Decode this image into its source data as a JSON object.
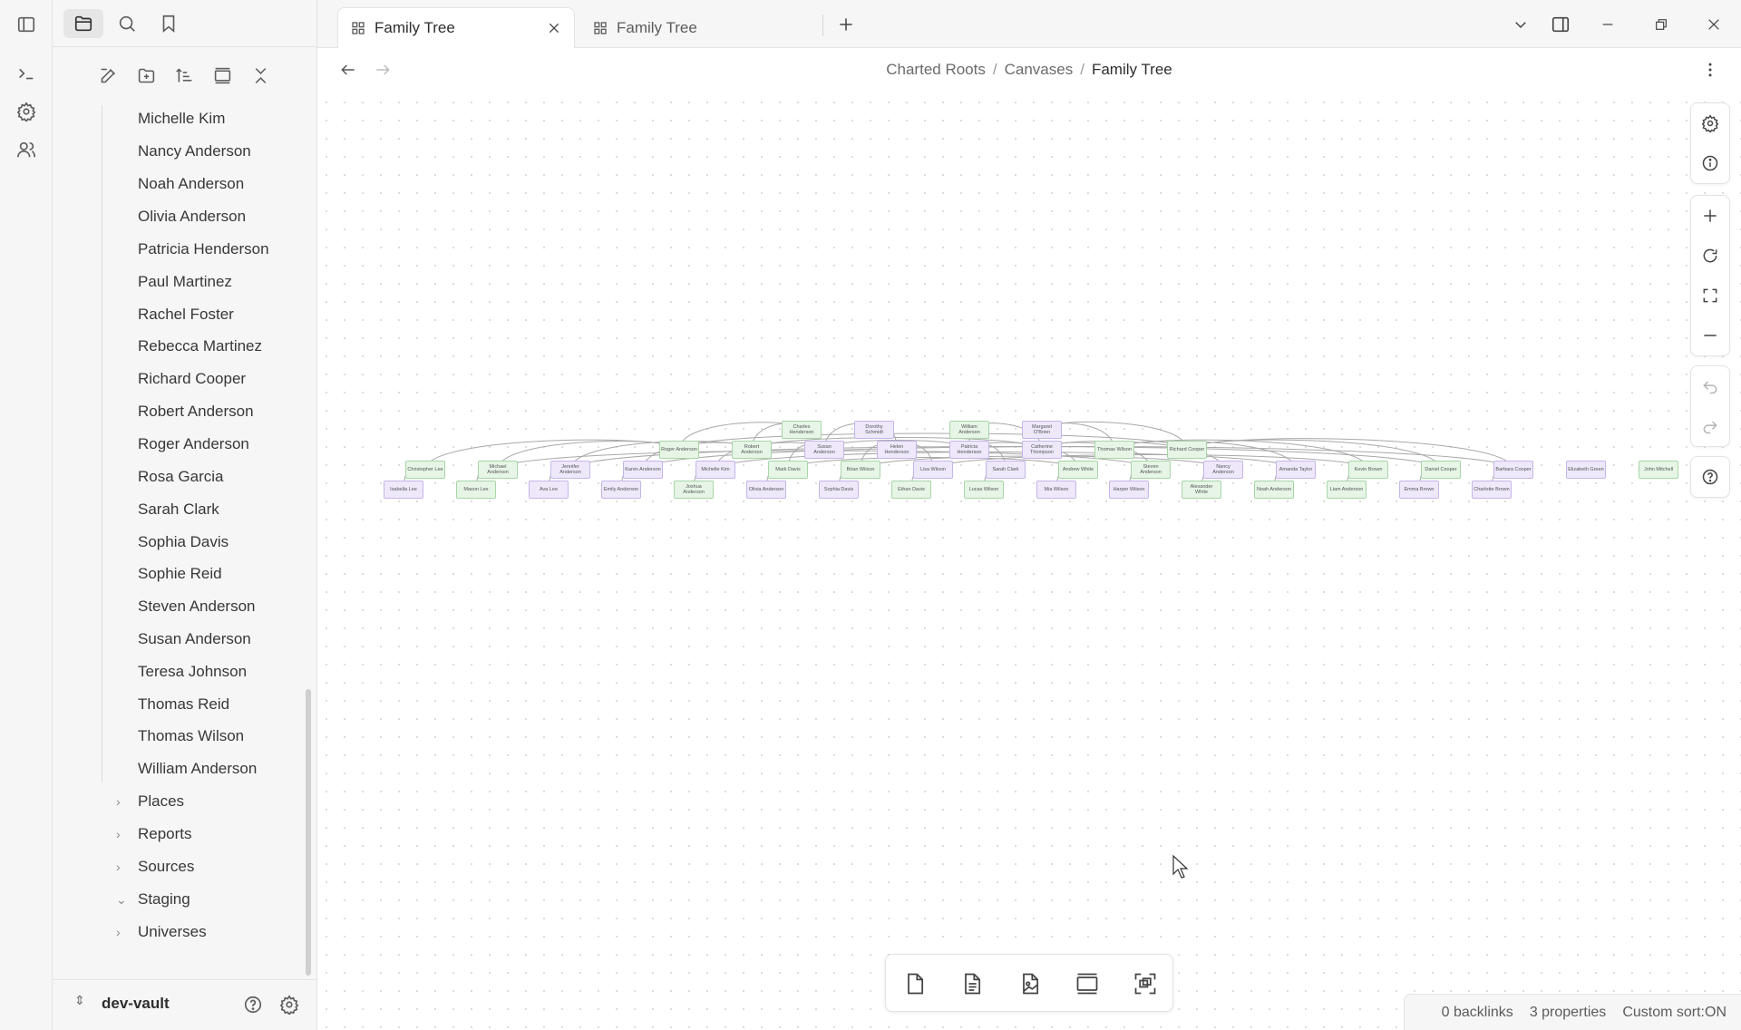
{
  "ribbon": {
    "icons": [
      "sidebar-toggle-icon",
      "terminal-icon",
      "settings-icon",
      "people-icon"
    ]
  },
  "sidebar": {
    "tabs": [
      "files-tab-icon",
      "search-icon",
      "bookmark-icon"
    ],
    "actions": [
      "new-note-icon",
      "new-folder-icon",
      "sort-icon",
      "collapse-view-icon",
      "collapse-all-icon"
    ],
    "people": [
      "Michelle Kim",
      "Nancy Anderson",
      "Noah Anderson",
      "Olivia Anderson",
      "Patricia Henderson",
      "Paul Martinez",
      "Rachel Foster",
      "Rebecca Martinez",
      "Richard Cooper",
      "Robert Anderson",
      "Roger Anderson",
      "Rosa Garcia",
      "Sarah Clark",
      "Sophia Davis",
      "Sophie Reid",
      "Steven Anderson",
      "Susan Anderson",
      "Teresa Johnson",
      "Thomas Reid",
      "Thomas Wilson",
      "William Anderson"
    ],
    "folders": [
      {
        "name": "Places",
        "expanded": false
      },
      {
        "name": "Reports",
        "expanded": false
      },
      {
        "name": "Sources",
        "expanded": false
      },
      {
        "name": "Staging",
        "expanded": true
      },
      {
        "name": "Universes",
        "expanded": false
      }
    ],
    "vault": "dev-vault"
  },
  "tabs": [
    {
      "label": "Family Tree",
      "active": true
    },
    {
      "label": "Family Tree",
      "active": false
    }
  ],
  "breadcrumb": {
    "parts": [
      "Charted Roots",
      "Canvases"
    ],
    "current": "Family Tree"
  },
  "canvas": {
    "node_colors": {
      "male": "#e6f5e6",
      "female": "#eee8fa"
    },
    "nodes": [
      {
        "label": "Charles Henderson",
        "g": "m"
      },
      {
        "label": "Dorothy Schmidt",
        "g": "f"
      },
      {
        "label": "William Anderson",
        "g": "m"
      },
      {
        "label": "Margaret O'Brien",
        "g": "f"
      },
      {
        "label": "Roger Anderson",
        "g": "m"
      },
      {
        "label": "Robert Anderson",
        "g": "m"
      },
      {
        "label": "Susan Anderson",
        "g": "f"
      },
      {
        "label": "Helen Henderson",
        "g": "f"
      },
      {
        "label": "Patricia Henderson",
        "g": "f"
      },
      {
        "label": "Catherine Thompson",
        "g": "f"
      },
      {
        "label": "Thomas Wilson",
        "g": "m"
      },
      {
        "label": "Richard Cooper",
        "g": "m"
      },
      {
        "label": "Christopher Lee",
        "g": "m"
      },
      {
        "label": "Michael Anderson",
        "g": "m"
      },
      {
        "label": "Jennifer Anderson",
        "g": "f"
      },
      {
        "label": "Karen Anderson",
        "g": "f"
      },
      {
        "label": "Michelle Kim",
        "g": "f"
      },
      {
        "label": "Mark Davis",
        "g": "m"
      },
      {
        "label": "Brian Wilson",
        "g": "m"
      },
      {
        "label": "Lisa Wilson",
        "g": "f"
      },
      {
        "label": "Sarah Clark",
        "g": "f"
      },
      {
        "label": "Andrew White",
        "g": "m"
      },
      {
        "label": "Steven Anderson",
        "g": "m"
      },
      {
        "label": "Nancy Anderson",
        "g": "f"
      },
      {
        "label": "Amanda Taylor",
        "g": "f"
      },
      {
        "label": "Kevin Brown",
        "g": "m"
      },
      {
        "label": "Daniel Cooper",
        "g": "m"
      },
      {
        "label": "Barbara Cooper",
        "g": "f"
      },
      {
        "label": "Elizabeth Green",
        "g": "f"
      },
      {
        "label": "John Mitchell",
        "g": "m"
      },
      {
        "label": "Isabella Lee",
        "g": "f"
      },
      {
        "label": "Mason Lee",
        "g": "m"
      },
      {
        "label": "Ava Lee",
        "g": "f"
      },
      {
        "label": "Emily Anderson",
        "g": "f"
      },
      {
        "label": "Joshua Anderson",
        "g": "m"
      },
      {
        "label": "Olivia Anderson",
        "g": "f"
      },
      {
        "label": "Sophia Davis",
        "g": "f"
      },
      {
        "label": "Ethan Davis",
        "g": "m"
      },
      {
        "label": "Lucas Wilson",
        "g": "m"
      },
      {
        "label": "Mia Wilson",
        "g": "f"
      },
      {
        "label": "Harper Wilson",
        "g": "f"
      },
      {
        "label": "Alexander White",
        "g": "m"
      },
      {
        "label": "Noah Anderson",
        "g": "m"
      },
      {
        "label": "Liam Anderson",
        "g": "m"
      },
      {
        "label": "Emma Brown",
        "g": "f"
      },
      {
        "label": "Charlotte Brown",
        "g": "f"
      }
    ]
  },
  "card_toolbar": [
    "add-card-icon",
    "add-note-icon",
    "add-media-icon",
    "add-group-icon",
    "select-frame-icon"
  ],
  "controls": {
    "top": [
      "canvas-settings-icon",
      "info-icon"
    ],
    "zoom": [
      "zoom-in-icon",
      "reset-zoom-icon",
      "zoom-to-fit-icon",
      "zoom-out-icon"
    ],
    "history": [
      "undo-icon",
      "redo-icon"
    ],
    "help": [
      "help-icon"
    ]
  },
  "status": {
    "backlinks": "0 backlinks",
    "properties": "3 properties",
    "sort": "Custom sort:ON"
  }
}
